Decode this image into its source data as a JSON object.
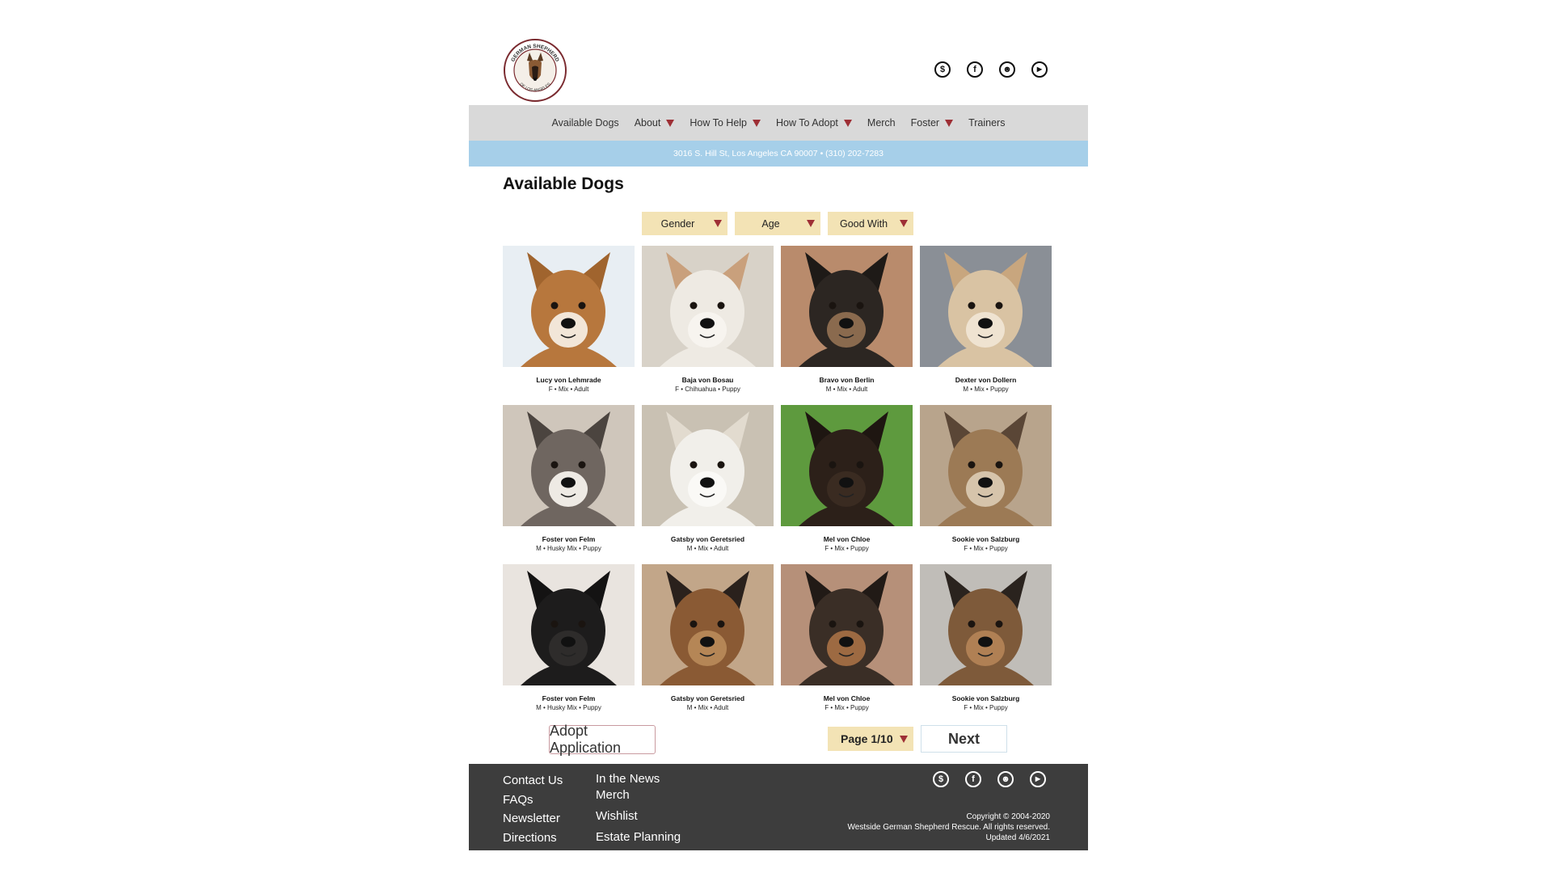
{
  "header": {
    "logo_text_top": "GERMAN SHEPHERD",
    "logo_text_left": "WESTSIDE",
    "logo_text_right": "RESCUE",
    "logo_text_bottom": "OF LOS ANGELES",
    "social": [
      {
        "icon": "donate-icon",
        "glyph": "$"
      },
      {
        "icon": "facebook-icon",
        "glyph": "f"
      },
      {
        "icon": "reddit-icon",
        "glyph": "☻"
      },
      {
        "icon": "youtube-icon",
        "glyph": "▶"
      }
    ]
  },
  "nav": {
    "items": [
      {
        "label": "Available Dogs",
        "dropdown": false
      },
      {
        "label": "About",
        "dropdown": true
      },
      {
        "label": "How To Help",
        "dropdown": true
      },
      {
        "label": "How To Adopt",
        "dropdown": true
      },
      {
        "label": "Merch",
        "dropdown": false
      },
      {
        "label": "Foster",
        "dropdown": true
      },
      {
        "label": "Trainers",
        "dropdown": false
      }
    ],
    "address": "3016 S. Hill St, Los Angeles CA 90007 •  (310) 202-7283"
  },
  "main": {
    "title": "Available Dogs",
    "filters": {
      "gender": "Gender",
      "age": "Age",
      "good_with": "Good With"
    },
    "dogs": [
      {
        "name": "Lucy von Lehmrade",
        "info": "F • Mix • Adult"
      },
      {
        "name": "Baja von Bosau",
        "info": "F • Chihuahua • Puppy"
      },
      {
        "name": "Bravo von Berlin",
        "info": "M • Mix • Adult"
      },
      {
        "name": "Dexter von Dollern",
        "info": "M • Mix • Puppy"
      },
      {
        "name": "Foster von Felm",
        "info": "M • Husky Mix • Puppy"
      },
      {
        "name": "Gatsby von Geretsried",
        "info": "M • Mix • Adult"
      },
      {
        "name": "Mel von Chloe",
        "info": "F • Mix • Puppy"
      },
      {
        "name": "Sookie von Salzburg",
        "info": "F • Mix • Puppy"
      },
      {
        "name": "Foster von Felm",
        "info": "M • Husky Mix • Puppy"
      },
      {
        "name": "Gatsby von Geretsried",
        "info": "M • Mix • Adult"
      },
      {
        "name": "Mel von Chloe",
        "info": "F • Mix • Puppy"
      },
      {
        "name": "Sookie von Salzburg",
        "info": "F • Mix • Puppy"
      }
    ],
    "adopt_label": "Adopt Application",
    "page_label": "Page 1/10",
    "next_label": "Next"
  },
  "footer": {
    "col1": [
      "Contact Us",
      "FAQs",
      "Newsletter",
      "Directions"
    ],
    "col2": [
      "In the News",
      "Merch",
      "Wishlist",
      "Estate Planning"
    ],
    "copyright": "Copyright © 2004-2020",
    "rights": "Westside German Shepherd Rescue. All rights reserved.",
    "updated": "Updated 4/6/2021"
  },
  "colors": {
    "nav_bg": "#d9d9d9",
    "address_bg": "#a6cfe9",
    "filter_bg": "#f3e3b5",
    "accent_triangle": "#9e2f35",
    "footer_bg": "#3d3d3d"
  }
}
